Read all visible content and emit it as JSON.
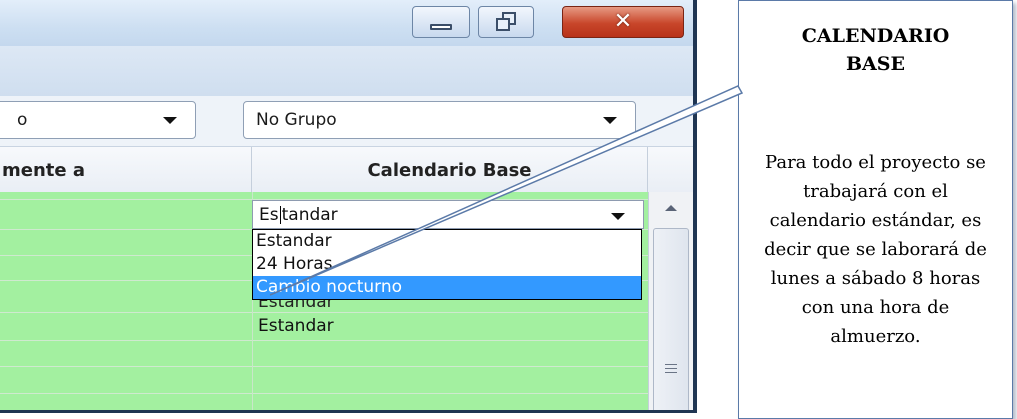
{
  "window": {
    "close_glyph": "✕"
  },
  "filters": {
    "left_value": "o",
    "right_value": "No Grupo"
  },
  "columns": {
    "left_header": "mente a",
    "right_header": "Calendario Base"
  },
  "editor": {
    "current_value_before_caret": "Es",
    "current_value_after_caret": "tandar",
    "options": [
      "Estandar",
      "24 Horas",
      "Cambio nocturno"
    ],
    "selected_option": "Cambio nocturno",
    "hidden_cell_value": "Estandar",
    "next_row_value": "Estandar"
  },
  "callout": {
    "title": "CALENDARIO BASE",
    "body": "Para todo el proyecto se trabajará con el calendario estándar, es decir que se laborará de lunes a sábado 8 horas con una hora de almuerzo."
  },
  "colors": {
    "grid_row": "#a3f0a0",
    "selection": "#3399ff",
    "close_button": "#c8462a"
  }
}
